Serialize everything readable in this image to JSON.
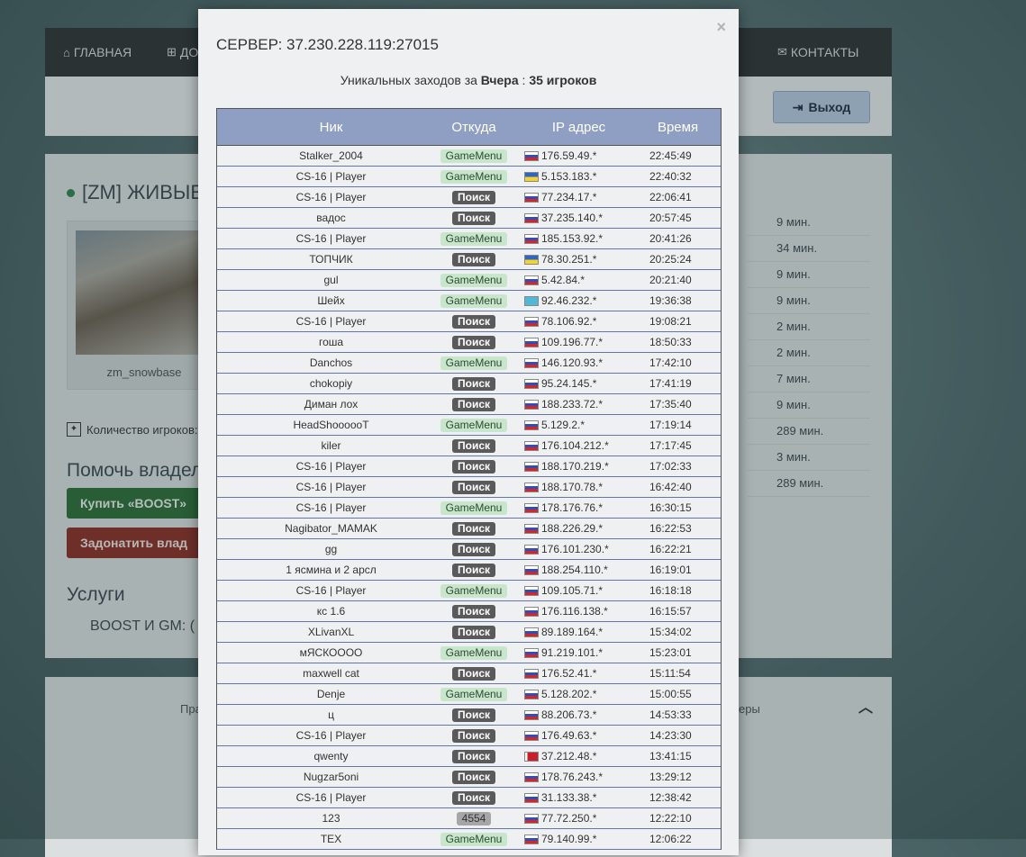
{
  "background": {
    "nav": {
      "home": "ГЛАВНАЯ",
      "add": "ДО",
      "contacts": "КОНТАКТЫ"
    },
    "logout": "Выход",
    "server_name": "[ZM] ЖИВЫЕ",
    "map_name": "zm_snowbase",
    "player_count_label": "Количество игроков:",
    "help_title": "Помочь владел",
    "boost_btn": "Купить «BOOST»",
    "donate_btn": "Задонатить влад",
    "services_title": "Услуги",
    "services_text": "BOOST И GM:   (",
    "right_times": [
      "9 мин.",
      "34 мин.",
      "9 мин.",
      "9 мин.",
      "2 мин.",
      "2 мин.",
      "7 мин.",
      "9 мин.",
      "289 мин.",
      "3 мин.",
      "289 мин."
    ],
    "footer_left": "Пра",
    "footer_right": "еры"
  },
  "modal": {
    "close": "×",
    "title": "СЕРВЕР: 37.230.228.119:27015",
    "summary_prefix": "Уникальных заходов за",
    "summary_period": "Вчера",
    "summary_sep": ":",
    "summary_count": "35 игроков",
    "columns": {
      "nick": "Ник",
      "from": "Откуда",
      "ip": "IP адрес",
      "time": "Время"
    },
    "rows": [
      {
        "nick": "Stalker_2004",
        "from": "GameMenu",
        "src": "gm",
        "flag": "ru",
        "ip": "176.59.49.*",
        "time": "22:45:49"
      },
      {
        "nick": "CS-16 | Player",
        "from": "GameMenu",
        "src": "gm",
        "flag": "ua",
        "ip": "5.153.183.*",
        "time": "22:40:32"
      },
      {
        "nick": "CS-16 | Player",
        "from": "Поиск",
        "src": "search",
        "flag": "ru",
        "ip": "77.234.17.*",
        "time": "22:06:41"
      },
      {
        "nick": "вадос",
        "from": "Поиск",
        "src": "search",
        "flag": "ru",
        "ip": "37.235.140.*",
        "time": "20:57:45"
      },
      {
        "nick": "CS-16 | Player",
        "from": "GameMenu",
        "src": "gm",
        "flag": "ru",
        "ip": "185.153.92.*",
        "time": "20:41:26"
      },
      {
        "nick": "ТОПЧИК",
        "from": "Поиск",
        "src": "search",
        "flag": "ua",
        "ip": "78.30.251.*",
        "time": "20:25:24"
      },
      {
        "nick": "gul",
        "from": "GameMenu",
        "src": "gm",
        "flag": "ru",
        "ip": "5.42.84.*",
        "time": "20:21:40"
      },
      {
        "nick": "Шейх",
        "from": "GameMenu",
        "src": "gm",
        "flag": "kz",
        "ip": "92.46.232.*",
        "time": "19:36:38"
      },
      {
        "nick": "CS-16 | Player",
        "from": "Поиск",
        "src": "search",
        "flag": "ru",
        "ip": "78.106.92.*",
        "time": "19:08:21"
      },
      {
        "nick": "гоша",
        "from": "Поиск",
        "src": "search",
        "flag": "ru",
        "ip": "109.196.77.*",
        "time": "18:50:33"
      },
      {
        "nick": "Danchos",
        "from": "GameMenu",
        "src": "gm",
        "flag": "ru",
        "ip": "146.120.93.*",
        "time": "17:42:10"
      },
      {
        "nick": "chokopiy",
        "from": "Поиск",
        "src": "search",
        "flag": "ru",
        "ip": "95.24.145.*",
        "time": "17:41:19"
      },
      {
        "nick": "Диман лох",
        "from": "Поиск",
        "src": "search",
        "flag": "ru",
        "ip": "188.233.72.*",
        "time": "17:35:40"
      },
      {
        "nick": "HeadShoooooT",
        "from": "GameMenu",
        "src": "gm",
        "flag": "ru",
        "ip": "5.129.2.*",
        "time": "17:19:14"
      },
      {
        "nick": "kiler",
        "from": "Поиск",
        "src": "search",
        "flag": "ru",
        "ip": "176.104.212.*",
        "time": "17:17:45"
      },
      {
        "nick": "CS-16 | Player",
        "from": "Поиск",
        "src": "search",
        "flag": "ru",
        "ip": "188.170.219.*",
        "time": "17:02:33"
      },
      {
        "nick": "CS-16 | Player",
        "from": "Поиск",
        "src": "search",
        "flag": "ru",
        "ip": "188.170.78.*",
        "time": "16:42:40"
      },
      {
        "nick": "CS-16 | Player",
        "from": "GameMenu",
        "src": "gm",
        "flag": "ru",
        "ip": "178.176.76.*",
        "time": "16:30:15"
      },
      {
        "nick": "Nagibator_MAMAK",
        "from": "Поиск",
        "src": "search",
        "flag": "ru",
        "ip": "188.226.29.*",
        "time": "16:22:53"
      },
      {
        "nick": "gg",
        "from": "Поиск",
        "src": "search",
        "flag": "ru",
        "ip": "176.101.230.*",
        "time": "16:22:21"
      },
      {
        "nick": "1 ясмина и 2 арсл",
        "from": "Поиск",
        "src": "search",
        "flag": "ru",
        "ip": "188.254.110.*",
        "time": "16:19:01"
      },
      {
        "nick": "CS-16 | Player",
        "from": "GameMenu",
        "src": "gm",
        "flag": "ru",
        "ip": "109.105.71.*",
        "time": "16:18:18"
      },
      {
        "nick": "кс 1.6",
        "from": "Поиск",
        "src": "search",
        "flag": "ru",
        "ip": "176.116.138.*",
        "time": "16:15:57"
      },
      {
        "nick": "XLivanXL",
        "from": "Поиск",
        "src": "search",
        "flag": "ru",
        "ip": "89.189.164.*",
        "time": "15:34:02"
      },
      {
        "nick": "мЯСКОООО",
        "from": "GameMenu",
        "src": "gm",
        "flag": "ru",
        "ip": "91.219.101.*",
        "time": "15:23:01"
      },
      {
        "nick": "maxwell cat",
        "from": "Поиск",
        "src": "search",
        "flag": "ru",
        "ip": "176.52.41.*",
        "time": "15:11:54"
      },
      {
        "nick": "Denje",
        "from": "GameMenu",
        "src": "gm",
        "flag": "ru",
        "ip": "5.128.202.*",
        "time": "15:00:55"
      },
      {
        "nick": "ц",
        "from": "Поиск",
        "src": "search",
        "flag": "ru",
        "ip": "88.206.73.*",
        "time": "14:53:33"
      },
      {
        "nick": "CS-16 | Player",
        "from": "Поиск",
        "src": "search",
        "flag": "ru",
        "ip": "176.49.63.*",
        "time": "14:23:30"
      },
      {
        "nick": "qwenty",
        "from": "Поиск",
        "src": "search",
        "flag": "by",
        "ip": "37.212.48.*",
        "time": "13:41:15"
      },
      {
        "nick": "Nugzar5oni",
        "from": "Поиск",
        "src": "search",
        "flag": "ru",
        "ip": "178.76.243.*",
        "time": "13:29:12"
      },
      {
        "nick": "CS-16 | Player",
        "from": "Поиск",
        "src": "search",
        "flag": "ru",
        "ip": "31.133.38.*",
        "time": "12:38:42"
      },
      {
        "nick": "123",
        "from": "4554",
        "src": "other",
        "flag": "ru",
        "ip": "77.72.250.*",
        "time": "12:22:10"
      },
      {
        "nick": "TEX",
        "from": "GameMenu",
        "src": "gm",
        "flag": "ru",
        "ip": "79.140.99.*",
        "time": "12:06:22"
      }
    ]
  }
}
